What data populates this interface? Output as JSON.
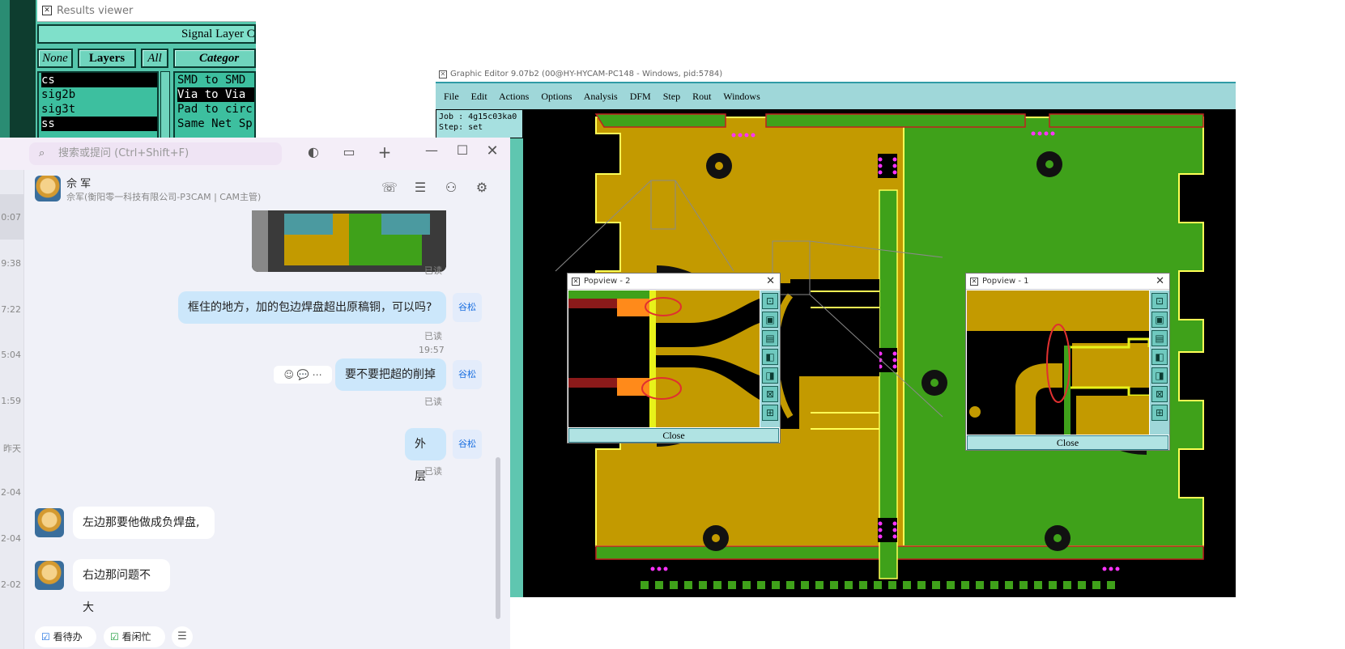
{
  "results_viewer": {
    "title": "Results viewer",
    "header": "Signal Layer Checks",
    "btn_none": "None",
    "btn_layers": "Layers",
    "btn_all": "All",
    "category_label": "Categor",
    "layers": [
      "cs",
      "sig2b",
      "sig3t",
      "ss"
    ],
    "categories": [
      "SMD to SMD",
      "Via to Via",
      "Pad to circ",
      "Same Net Sp"
    ]
  },
  "graphic_editor": {
    "title": "Graphic Editor 9.07b2 (00@HY-HYCAM-PC148 - Windows, pid:5784)",
    "menu": [
      "File",
      "Edit",
      "Actions",
      "Options",
      "Analysis",
      "DFM",
      "Step",
      "Rout",
      "Windows"
    ],
    "job": "Job : 4g15c03ka0",
    "step": "Step: set",
    "popview2": {
      "title": "Popview - 2",
      "close": "Close",
      "x": "✕"
    },
    "popview1": {
      "title": "Popview - 1",
      "close": "Close",
      "x": "✕"
    }
  },
  "chat": {
    "search_placeholder": "搜索或提问 (Ctrl+Shift+F)",
    "contact_name": "佘 军",
    "contact_sub": "佘军(衡阳零一科技有限公司-P3CAM | CAM主管)",
    "times": [
      "0:07",
      "9:38",
      "7:22",
      "5:04",
      "1:59",
      "昨天",
      "2-04",
      "2-04",
      "2-02"
    ],
    "messages": [
      {
        "from": "me",
        "text": "框住的地方，加的包边焊盘超出原稿铜，可以吗?",
        "status": "已读",
        "avatar": "谷松"
      },
      {
        "from": "me",
        "text": "要不要把超的削掉",
        "status": "已读",
        "avatar": "谷松",
        "time": "19:57"
      },
      {
        "from": "me",
        "text": "外层",
        "status": "已读",
        "avatar": "谷松"
      },
      {
        "from": "them",
        "text": "左边那要他做成负焊盘,"
      },
      {
        "from": "them",
        "text": "右边那问题不大"
      }
    ],
    "image_read": "已读",
    "footer": {
      "todo": "看待办",
      "busy": "看闲忙"
    }
  }
}
